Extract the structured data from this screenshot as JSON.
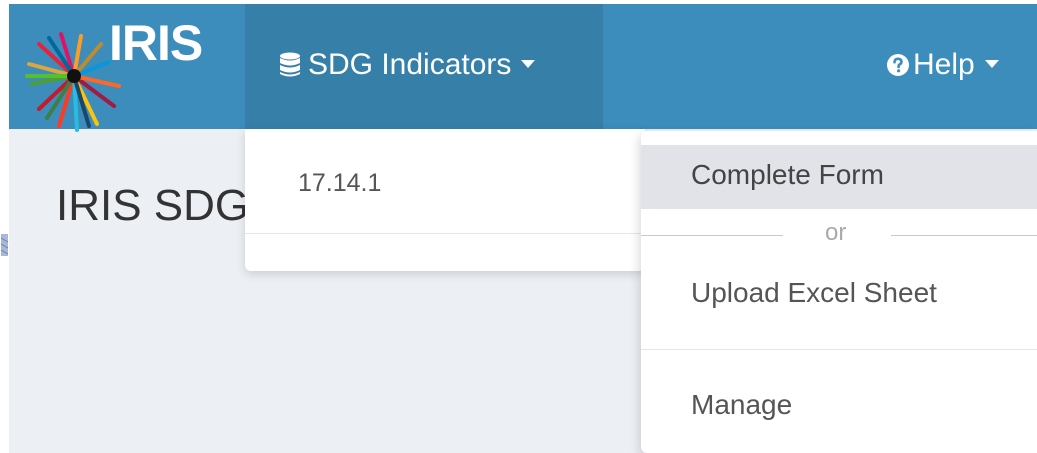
{
  "brand": {
    "logo_text": "IRIS"
  },
  "navbar": {
    "sdg_menu_label": "SDG Indicators",
    "help_menu_label": "Help"
  },
  "page": {
    "title": "IRIS SDG"
  },
  "sdg_dropdown": {
    "items": [
      {
        "label": "17.14.1"
      }
    ]
  },
  "help_dropdown": {
    "complete_form_label": "Complete Form",
    "or_label": "or",
    "upload_label": "Upload Excel Sheet",
    "manage_label": "Manage"
  },
  "icons": {
    "sdg_menu": "database-icon",
    "help_menu": "question-circle-icon",
    "caret": "caret-down-icon"
  },
  "colors": {
    "navbar": "#3c8dbc",
    "navbar_active": "#367fa9",
    "content_bg": "#ecf0f5",
    "menu_hover": "#e1e3e9"
  }
}
